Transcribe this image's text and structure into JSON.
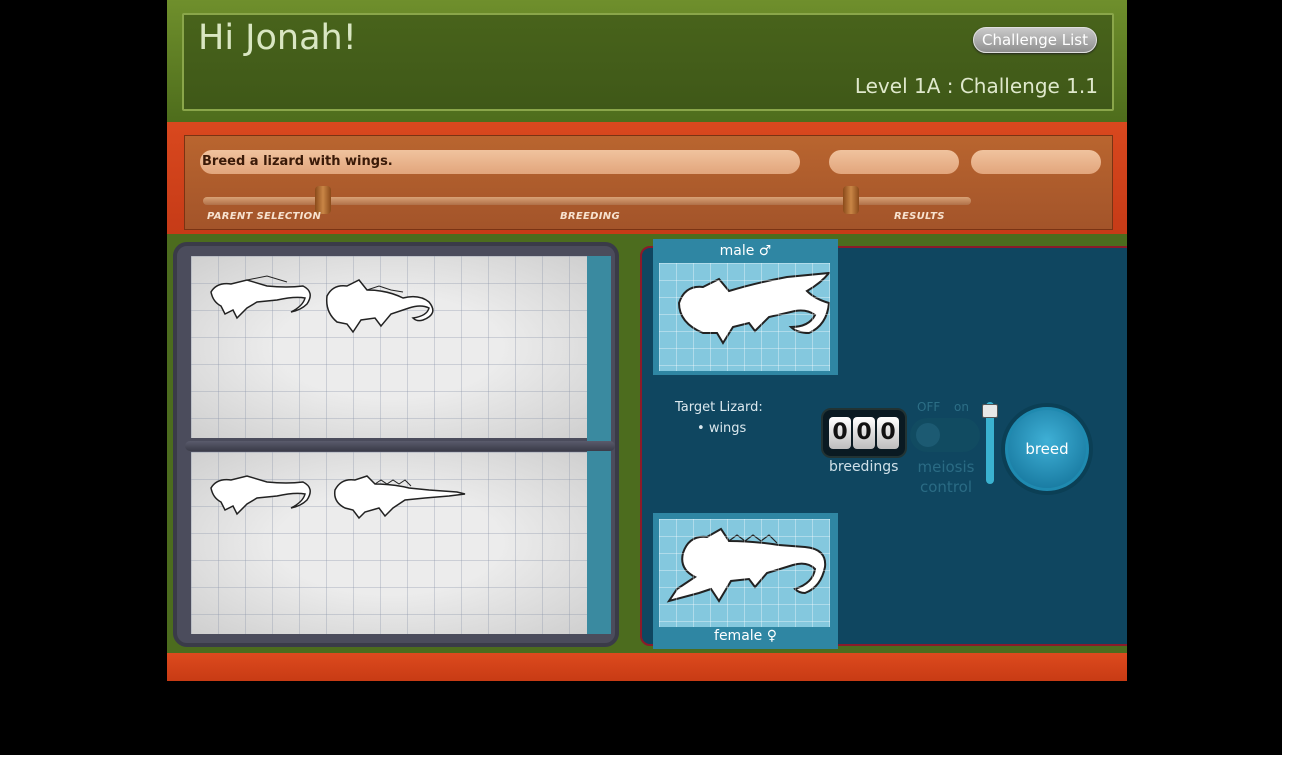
{
  "header": {
    "greeting": "Hi Jonah!",
    "challenge_list_button": "Challenge List",
    "level": "Level 1A : Challenge 1.1"
  },
  "goal": {
    "text": "Breed a lizard with wings.",
    "stages": [
      "PARENT SELECTION",
      "BREEDING",
      "RESULTS"
    ]
  },
  "parents": {
    "male_label": "male ♂",
    "female_label": "female ♀"
  },
  "target": {
    "title": "Target Lizard:",
    "traits": [
      "wings"
    ]
  },
  "counter": {
    "digits": [
      "0",
      "0",
      "0"
    ],
    "label": "breedings"
  },
  "meiosis": {
    "off": "OFF",
    "on": "on",
    "label": "meiosis control"
  },
  "breed_button": "breed",
  "colors": {
    "header_green": "#4e6d1c",
    "goal_orange": "#c63b17",
    "panel_blue": "#0f4660",
    "card_blue": "#2f86a3"
  }
}
